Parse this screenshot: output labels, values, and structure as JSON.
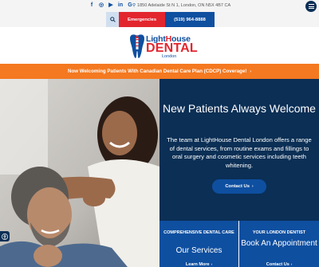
{
  "topbar": {
    "social_icons": [
      "facebook-icon",
      "instagram-icon",
      "youtube-icon",
      "linkedin-icon",
      "google-icon"
    ],
    "social_glyphs": [
      "f",
      "◎",
      "▶",
      "in",
      "G"
    ],
    "address": "1850 Adelaide St N 1, London, ON N5X 4B7 CA"
  },
  "actions": {
    "emergencies_label": "Emergencies",
    "phone_label": "(519) 964-8888"
  },
  "logo": {
    "line1_prefix": "Light",
    "line1_h": "H",
    "line1_suffix": "ouse",
    "line2": "DENTAL",
    "line3": "London"
  },
  "banner": {
    "text": "Now Welcoming Patients With Canadian Dental Care Plan (CDCP) Coverage!",
    "arrow": "›"
  },
  "hero": {
    "heading": "New Patients Always Welcome",
    "body": "The team at LightHouse Dental London offers a range of dental services, from routine exams and fillings to oral surgery and cosmetic services including teeth whitening.",
    "cta_label": "Contact Us",
    "cta_arrow": "›"
  },
  "cards": [
    {
      "kicker": "COMPREHENSIVE DENTAL CARE",
      "title": "Our Services",
      "link": "Learn More",
      "arrow": "›"
    },
    {
      "kicker": "YOUR LONDON DENTIST",
      "title": "Book An Appointment",
      "link": "Contact Us",
      "arrow": "›"
    }
  ],
  "colors": {
    "navy": "#0b2f55",
    "blue": "#0e4fa0",
    "red": "#e3262e",
    "orange": "#f47920"
  }
}
